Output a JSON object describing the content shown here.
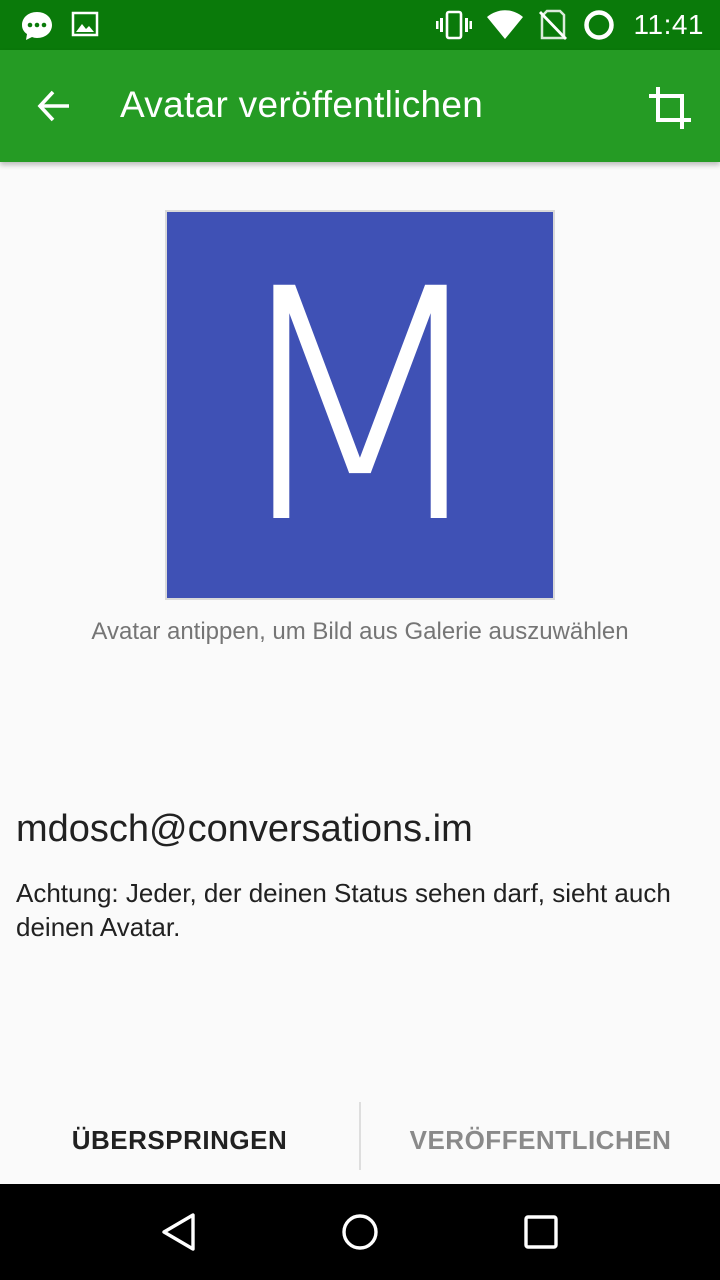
{
  "status_bar": {
    "time": "11:41",
    "left_icons": [
      "chat-bubble-icon",
      "image-icon"
    ],
    "right_icons": [
      "vibrate-icon",
      "wifi-icon",
      "no-sim-icon",
      "battery-ring-icon"
    ],
    "background": "#0a7a0a"
  },
  "app_bar": {
    "title": "Avatar veröffentlichen",
    "back_icon": "arrow-back-icon",
    "action_icon": "crop-icon",
    "background": "#259b24"
  },
  "avatar": {
    "letter": "M",
    "background": "#3f51b5"
  },
  "hint": "Avatar antippen, um Bild aus Galerie auszuwählen",
  "account": "mdosch@conversations.im",
  "warning": "Achtung: Jeder, der deinen Status sehen darf, sieht auch deinen Avatar.",
  "buttons": {
    "skip": "ÜBERSPRINGEN",
    "publish": "VERÖFFENTLICHEN"
  },
  "nav_bar": {
    "icons": [
      "back-triangle-icon",
      "home-circle-icon",
      "recents-square-icon"
    ]
  }
}
